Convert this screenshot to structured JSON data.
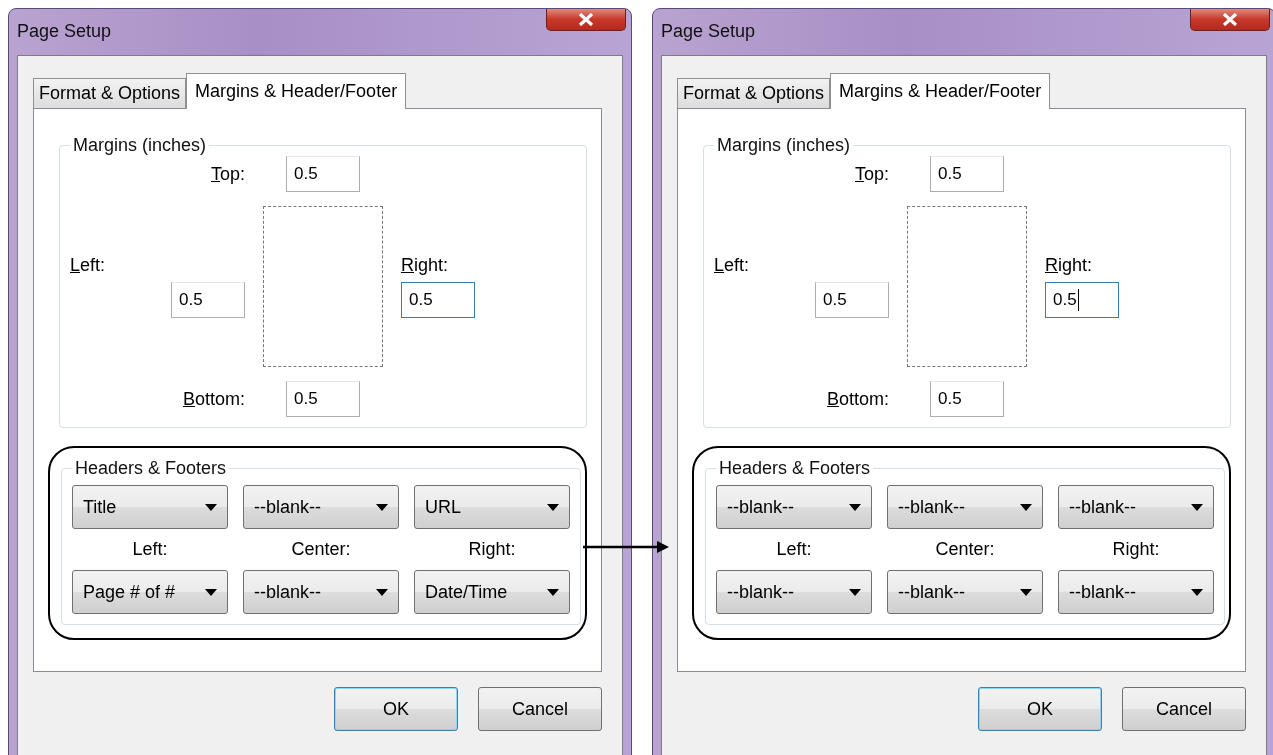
{
  "dialogs": [
    {
      "title": "Page Setup",
      "tabs": [
        {
          "label": "Format & Options",
          "selected": false
        },
        {
          "label": "Margins & Header/Footer",
          "selected": true
        }
      ],
      "margins": {
        "legend": "Margins (inches)",
        "top": {
          "label": "Top:",
          "value": "0.5",
          "focused": false,
          "caret": false
        },
        "left": {
          "label": "Left:",
          "value": "0.5",
          "focused": false,
          "caret": false
        },
        "right": {
          "label": "Right:",
          "value": "0.5",
          "focused": true,
          "caret": false
        },
        "bottom": {
          "label": "Bottom:",
          "value": "0.5",
          "focused": false,
          "caret": false
        }
      },
      "headers_footers": {
        "legend": "Headers & Footers",
        "headers": [
          "Title",
          "--blank--",
          "URL"
        ],
        "position_labels": [
          "Left:",
          "Center:",
          "Right:"
        ],
        "footers": [
          "Page # of #",
          "--blank--",
          "Date/Time"
        ]
      },
      "buttons": [
        {
          "label": "OK",
          "default": true
        },
        {
          "label": "Cancel",
          "default": false
        }
      ]
    },
    {
      "title": "Page Setup",
      "tabs": [
        {
          "label": "Format & Options",
          "selected": false
        },
        {
          "label": "Margins & Header/Footer",
          "selected": true
        }
      ],
      "margins": {
        "legend": "Margins (inches)",
        "top": {
          "label": "Top:",
          "value": "0.5",
          "focused": false,
          "caret": false
        },
        "left": {
          "label": "Left:",
          "value": "0.5",
          "focused": false,
          "caret": false
        },
        "right": {
          "label": "Right:",
          "value": "0.5",
          "focused": true,
          "caret": true
        },
        "bottom": {
          "label": "Bottom:",
          "value": "0.5",
          "focused": false,
          "caret": false
        }
      },
      "headers_footers": {
        "legend": "Headers & Footers",
        "headers": [
          "--blank--",
          "--blank--",
          "--blank--"
        ],
        "position_labels": [
          "Left:",
          "Center:",
          "Right:"
        ],
        "footers": [
          "--blank--",
          "--blank--",
          "--blank--"
        ]
      },
      "buttons": [
        {
          "label": "OK",
          "default": true
        },
        {
          "label": "Cancel",
          "default": false
        }
      ]
    }
  ]
}
